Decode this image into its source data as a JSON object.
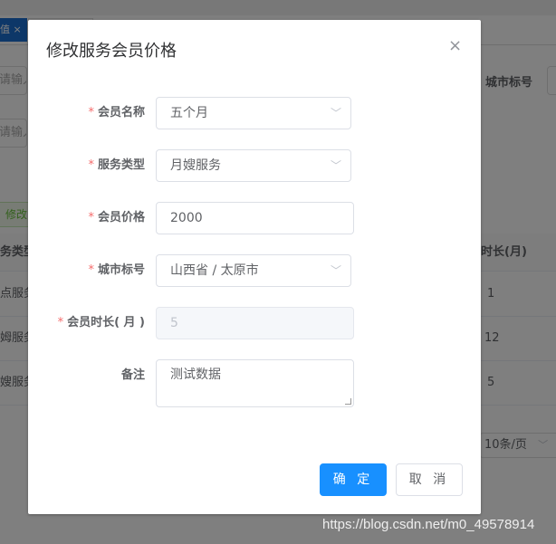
{
  "background": {
    "tab_label": "值",
    "tab_close": "×",
    "input_placeholder": "请输入",
    "city_label": "城市标号",
    "edit_button": "修改",
    "table": {
      "headers": [
        "务类型",
        "时长(月)"
      ],
      "rows": [
        [
          "点服务",
          "1"
        ],
        [
          "姆服务",
          "12"
        ],
        [
          "嫂服务",
          "5"
        ]
      ]
    },
    "page_size": "10条/页"
  },
  "dialog": {
    "title": "修改服务会员价格",
    "close": "×",
    "fields": [
      {
        "label": "会员名称",
        "required": true,
        "value": "五个月",
        "type": "select"
      },
      {
        "label": "服务类型",
        "required": true,
        "value": "月嫂服务",
        "type": "select"
      },
      {
        "label": "会员价格",
        "required": true,
        "value": "2000",
        "type": "input"
      },
      {
        "label": "城市标号",
        "required": true,
        "value": "山西省 / 太原市",
        "type": "cascader"
      },
      {
        "label": "会员时长( 月 )",
        "required": true,
        "value": "5",
        "type": "input",
        "disabled": true
      },
      {
        "label": "备注",
        "required": false,
        "value": "测试数据",
        "type": "textarea"
      }
    ],
    "confirm": "确 定",
    "cancel": "取 消"
  },
  "watermark": "https://blog.csdn.net/m0_49578914",
  "colors": {
    "primary": "#1890ff",
    "required": "#f56c6c",
    "mask": "rgba(0,0,0,0.5)"
  }
}
